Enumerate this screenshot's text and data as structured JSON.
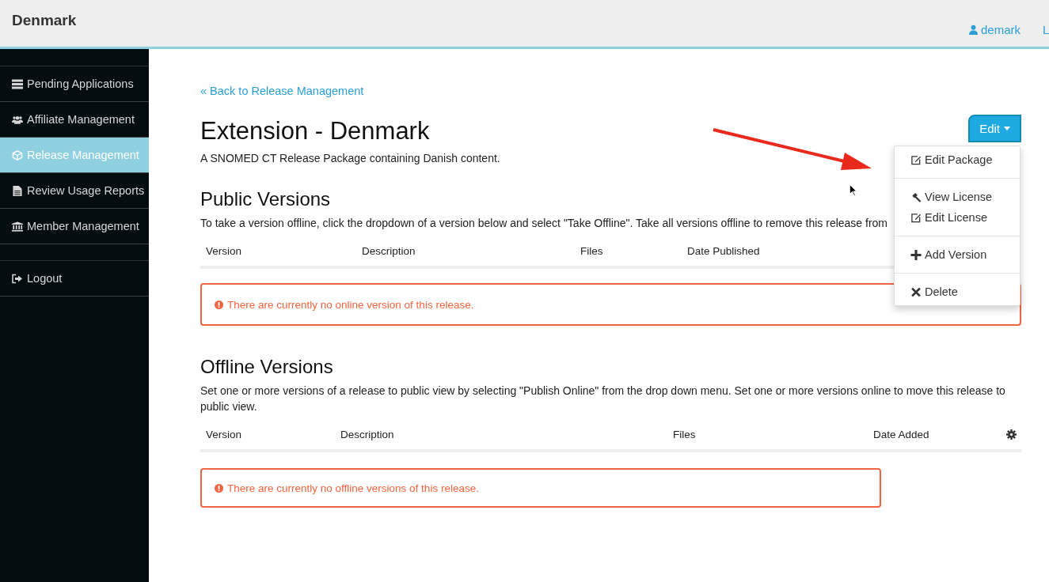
{
  "header": {
    "brand": "Denmark",
    "user": "demark",
    "cut_link": "L"
  },
  "sidebar": {
    "items": [
      {
        "label": "Pending Applications",
        "selected": false
      },
      {
        "label": "Affiliate Management",
        "selected": false
      },
      {
        "label": "Release Management",
        "selected": true
      },
      {
        "label": "Review Usage Reports",
        "selected": false
      },
      {
        "label": "Member Management",
        "selected": false
      }
    ],
    "logout": "Logout"
  },
  "back_link": "« Back to Release Management",
  "title": "Extension - Denmark",
  "subtitle": "A SNOMED CT Release Package  containing Danish content.",
  "edit_button": "Edit",
  "edit_menu": {
    "groups": [
      [
        {
          "label": "Edit Package"
        }
      ],
      [
        {
          "label": "View License"
        },
        {
          "label": "Edit License"
        }
      ],
      [
        {
          "label": "Add Version"
        }
      ],
      [
        {
          "label": "Delete"
        }
      ]
    ]
  },
  "public_versions": {
    "heading": "Public Versions",
    "description": "To take a version offline, click the dropdown of a version below and select \"Take Offline\". Take all versions offline to remove this release from",
    "columns": [
      "Version",
      "Description",
      "Files",
      "Date Published"
    ],
    "alert": "There are currently no online version of this release."
  },
  "offline_versions": {
    "heading": "Offline Versions",
    "description": "Set one or more versions of a release to public view by selecting \"Publish Online\" from the drop down menu. Set one or more versions online to move this release to public view.",
    "columns": [
      "Version",
      "Description",
      "Files",
      "Date Added"
    ],
    "alert": "There are currently no offline versions of this release."
  }
}
